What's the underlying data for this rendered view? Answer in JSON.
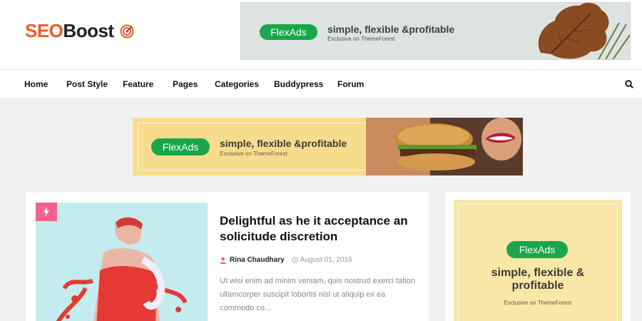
{
  "logo": {
    "part1": "SEO",
    "part2": "Boost",
    "icon": "target-icon"
  },
  "ads": {
    "top": {
      "cta": "FlexAds",
      "headline": "simple, flexible &profitable",
      "sub": "Exclusive on ThemeForest"
    },
    "middle": {
      "cta": "FlexAds",
      "headline": "simple, flexible &profitable",
      "sub": "Exclusive on ThemeForest"
    },
    "sidebar": {
      "cta": "FlexAds",
      "headline": "simple, flexible & profitable",
      "sub": "Exclusive on ThemeForest"
    }
  },
  "nav": {
    "items": [
      "Home",
      "Post Style",
      "Feature",
      "Pages",
      "Categories",
      "Buddypress",
      "Forum"
    ],
    "search_icon": "search-icon"
  },
  "post": {
    "badge_icon": "flash-icon",
    "title": "Delightful as he it acceptance an solicitude discretion",
    "author": "Rina Chaudhary",
    "date": "August 01, 2016",
    "excerpt": "Ut wisi enim ad minim veniam, quis nostrud exerci tation ullamcorper suscipit lobortis nisl ut aliquip ex ea commodo co..."
  },
  "colors": {
    "brand": "#ef5a28",
    "ad_green": "#1aa64a",
    "badge_pink": "#f06292"
  }
}
